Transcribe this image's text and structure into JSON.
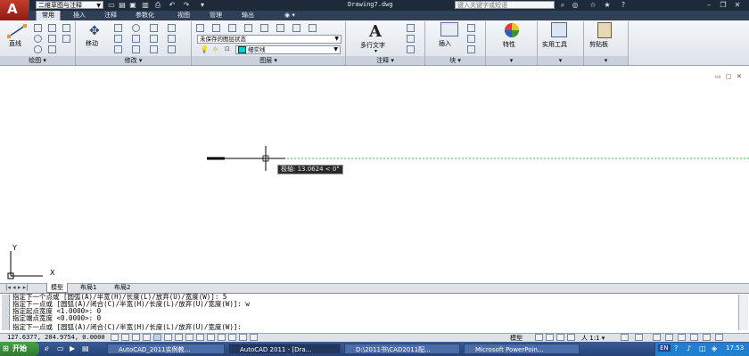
{
  "titlebar": {
    "workspace": "二维草图与注释",
    "document_title": "Drawing7.dwg",
    "search_placeholder": "键入关键字或短语",
    "app_logo": "A"
  },
  "tabs": [
    "常用",
    "插入",
    "注释",
    "参数化",
    "视图",
    "管理",
    "输出"
  ],
  "ribbon": {
    "draw": {
      "title": "绘图",
      "line_label": "直线"
    },
    "modify": {
      "title": "修改",
      "move_label": "移动"
    },
    "layers": {
      "title": "图层",
      "layer_state": "未保存的图层状态",
      "current_layer": "细实线"
    },
    "annotation": {
      "title": "注释",
      "mtext_label": "多行文字",
      "mtext_icon": "A"
    },
    "block": {
      "title": "块",
      "insert_label": "插入"
    },
    "properties": {
      "label": "特性"
    },
    "utilities": {
      "label": "实用工具"
    },
    "clipboard": {
      "label": "剪贴板"
    }
  },
  "canvas": {
    "polar_tooltip": "极轴: 13.0624 < 0°",
    "ucs_y": "Y",
    "ucs_x": "X"
  },
  "layout_tabs": [
    "模型",
    "布局1",
    "布局2"
  ],
  "command_lines": [
    "指定下一个点或 [圆弧(A)/半宽(H)/长度(L)/放弃(U)/宽度(W)]: 5",
    "指定下一点或 [圆弧(A)/闭合(C)/半宽(H)/长度(L)/放弃(U)/宽度(W)]: w",
    "指定起点宽度 <1.0000>: 0",
    "指定端点宽度 <0.0000>: 0",
    "指定下一点或 [圆弧(A)/闭合(C)/半宽(H)/长度(L)/放弃(U)/宽度(W)]:"
  ],
  "statusbar": {
    "coordinates": "127.6377, 204.9754, 0.0000",
    "model_label": "模型",
    "scale": "1:1"
  },
  "taskbar": {
    "start_label": "开始",
    "tasks": [
      "AutoCAD_2011实例教...",
      "AutoCAD 2011 - [Dra...",
      "D:\\2011书\\CAD2011配...",
      "Microsoft PowerPoin..."
    ],
    "lang": "EN",
    "clock": "17:53"
  }
}
